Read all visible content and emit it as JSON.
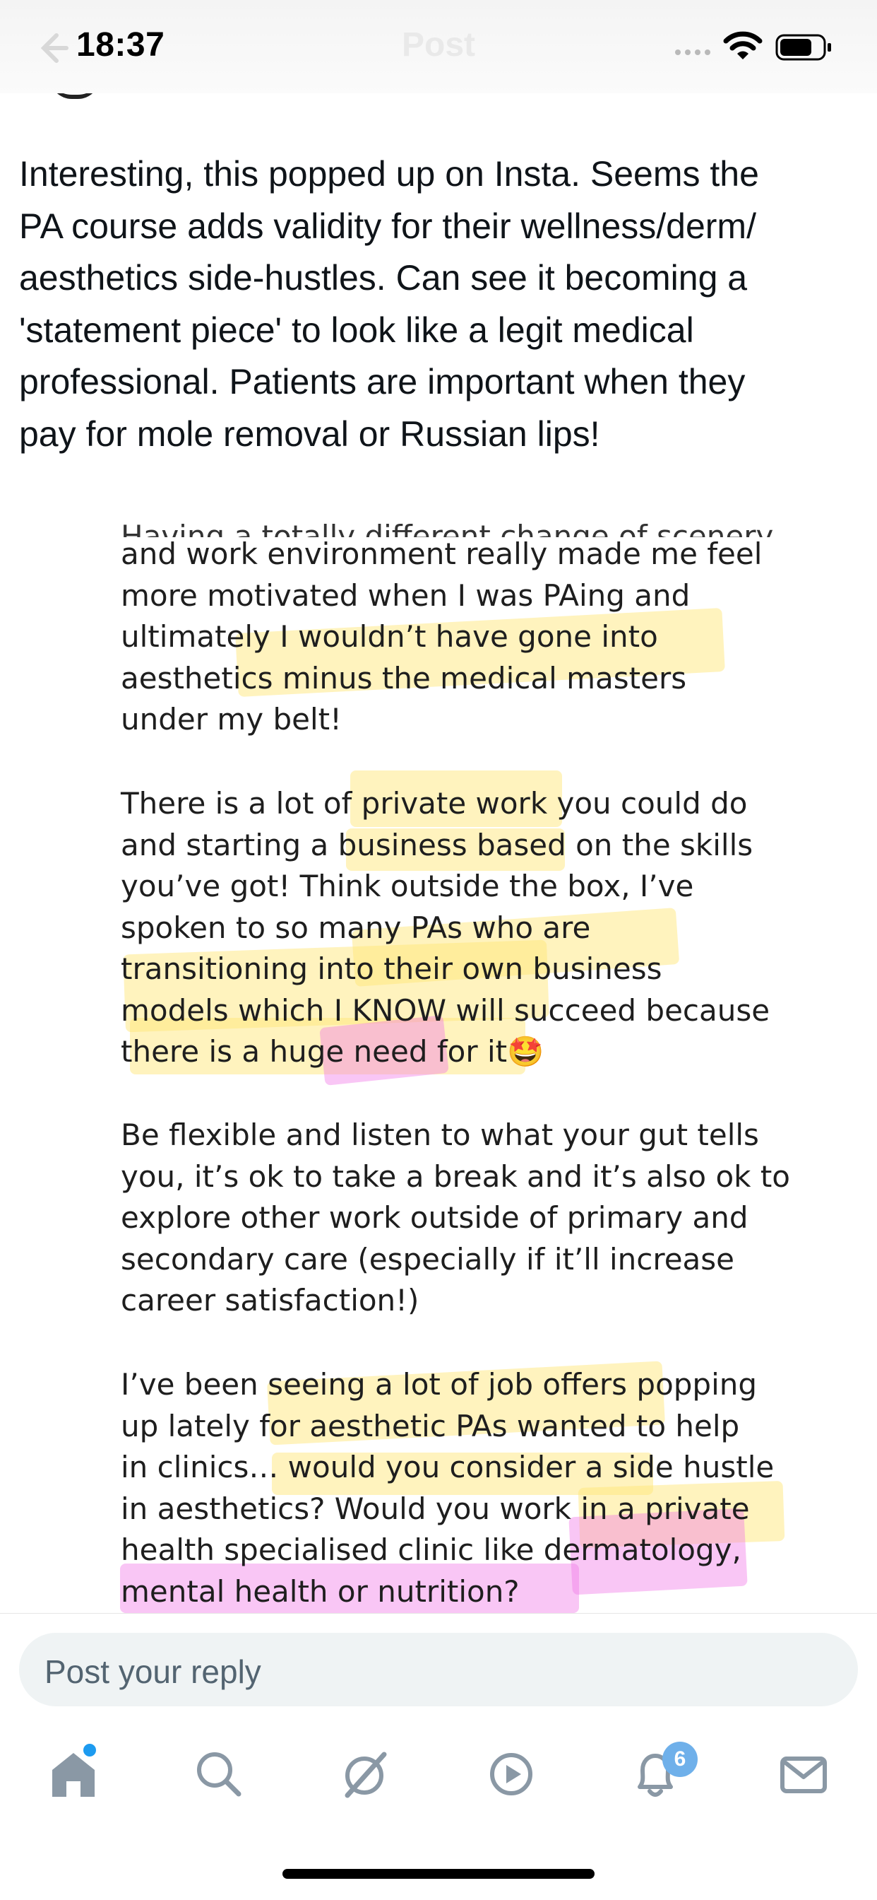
{
  "status_bar": {
    "time": "18:37",
    "title": "Post"
  },
  "tweet": {
    "text": "Interesting, this popped up on Insta. Seems the PA course adds validity for their wellness/derm/ aesthetics side-hustles. Can see it becoming a 'statement piece' to look like a legit medical professional. Patients are important when they pay for mole removal or Russian lips!",
    "lines": [
      "Interesting, this popped up on Insta. Seems the",
      "PA course adds validity for their wellness/derm/",
      "aesthetics side-hustles. Can see it becoming a",
      "'statement piece' to look like a legit medical",
      "professional. Patients are important when they",
      "pay for mole removal or Russian lips!"
    ]
  },
  "embedded_image": {
    "cut_line": "Having a totally different change of scenery",
    "paragraphs": [
      {
        "lines": [
          "and work environment really made me feel",
          "more motivated when I was PAing and",
          "ultimately I wouldn’t have gone into",
          "aesthetics minus the medical masters",
          "under my belt!"
        ]
      },
      {
        "lines": [
          "There is a lot of private work you could do",
          "and starting a business based on the skills",
          "you’ve got! Think outside the box, I’ve",
          "spoken to so many PAs who are",
          "transitioning into their own business",
          "models which I KNOW will succeed because",
          "there is a huge need for it🤩"
        ]
      },
      {
        "lines": [
          "Be flexible and listen to what your gut tells",
          "you, it’s ok to take a break and it’s also ok to",
          "explore other work outside of primary and",
          "secondary care (especially if it’ll increase",
          "career satisfaction!)"
        ]
      },
      {
        "lines": [
          "I’ve been seeing a lot of job offers popping",
          "up lately for aesthetic PAs wanted to help",
          "in clinics… would you consider a side hustle",
          "in aesthetics? Would you work in a private",
          "health specialised clinic like dermatology,",
          "mental health or nutrition?"
        ]
      }
    ]
  },
  "reply": {
    "placeholder": "Post your reply"
  },
  "nav": {
    "items": [
      "home-icon",
      "search-icon",
      "grok-icon",
      "video-icon",
      "notifications-icon",
      "messages-icon"
    ],
    "notification_count": "6"
  },
  "colors": {
    "highlight_yellow": "#ffe678",
    "highlight_pink": "#f078e6",
    "accent": "#1d9bf0"
  }
}
